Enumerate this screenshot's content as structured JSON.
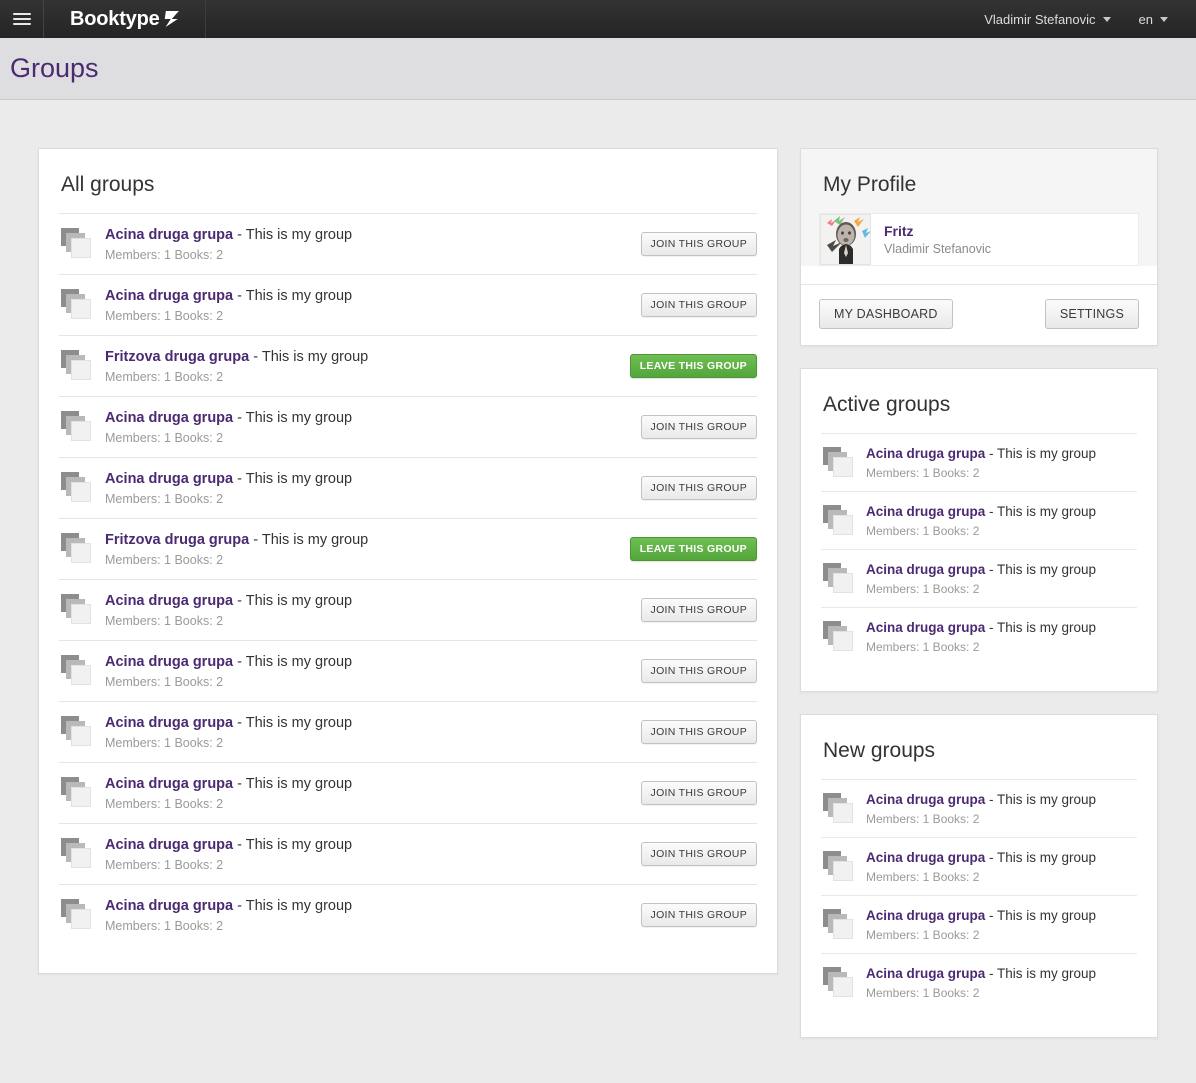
{
  "topbar": {
    "menu_icon": "hamburger-icon",
    "brand": "Booktype",
    "brand_arrow_icon": "chevron-right-arrow-icon",
    "user_name": "Vladimir Stefanovic",
    "user_caret_icon": "caret-down-icon",
    "language": "en",
    "lang_caret_icon": "caret-down-icon"
  },
  "page": {
    "title": "Groups",
    "title_color": "#4b2a72",
    "background": "#ebebeb"
  },
  "all_groups": {
    "heading": "All groups",
    "join_label": "JOIN THIS GROUP",
    "leave_label": "LEAVE THIS GROUP",
    "rows": [
      {
        "name": "Acina druga grupa",
        "desc": " - This is my group",
        "meta": "Members: 1 Books: 2",
        "joined": false
      },
      {
        "name": "Acina druga grupa",
        "desc": " - This is my group",
        "meta": "Members: 1 Books: 2",
        "joined": false
      },
      {
        "name": "Fritzova druga grupa",
        "desc": " - This is my group",
        "meta": "Members: 1 Books: 2",
        "joined": true
      },
      {
        "name": "Acina druga grupa",
        "desc": " - This is my group",
        "meta": "Members: 1 Books: 2",
        "joined": false
      },
      {
        "name": "Acina druga grupa",
        "desc": " - This is my group",
        "meta": "Members: 1 Books: 2",
        "joined": false
      },
      {
        "name": "Fritzova druga grupa",
        "desc": " - This is my group",
        "meta": "Members: 1 Books: 2",
        "joined": true
      },
      {
        "name": "Acina druga grupa",
        "desc": " - This is my group",
        "meta": "Members: 1 Books: 2",
        "joined": false
      },
      {
        "name": "Acina druga grupa",
        "desc": " - This is my group",
        "meta": "Members: 1 Books: 2",
        "joined": false
      },
      {
        "name": "Acina druga grupa",
        "desc": " - This is my group",
        "meta": "Members: 1 Books: 2",
        "joined": false
      },
      {
        "name": "Acina druga grupa",
        "desc": " - This is my group",
        "meta": "Members: 1 Books: 2",
        "joined": false
      },
      {
        "name": "Acina druga grupa",
        "desc": " - This is my group",
        "meta": "Members: 1 Books: 2",
        "joined": false
      },
      {
        "name": "Acina druga grupa",
        "desc": " - This is my group",
        "meta": "Members: 1 Books: 2",
        "joined": false
      }
    ]
  },
  "profile": {
    "heading": "My Profile",
    "avatar_icon": "user-avatar-photo",
    "nickname": "Fritz",
    "full_name": "Vladimir Stefanovic",
    "dashboard_label": "MY DASHBOARD",
    "settings_label": "SETTINGS"
  },
  "active_groups": {
    "heading": "Active groups",
    "rows": [
      {
        "name": "Acina druga grupa",
        "desc": " - This is my group",
        "meta": "Members: 1 Books: 2"
      },
      {
        "name": "Acina druga grupa",
        "desc": " - This is my group",
        "meta": "Members: 1 Books: 2"
      },
      {
        "name": "Acina druga grupa",
        "desc": " - This is my group",
        "meta": "Members: 1 Books: 2"
      },
      {
        "name": "Acina druga grupa",
        "desc": " - This is my group",
        "meta": "Members: 1 Books: 2"
      }
    ]
  },
  "new_groups": {
    "heading": "New groups",
    "rows": [
      {
        "name": "Acina druga grupa",
        "desc": " - This is my group",
        "meta": "Members: 1 Books: 2"
      },
      {
        "name": "Acina druga grupa",
        "desc": " - This is my group",
        "meta": "Members: 1 Books: 2"
      },
      {
        "name": "Acina druga grupa",
        "desc": " - This is my group",
        "meta": "Members: 1 Books: 2"
      },
      {
        "name": "Acina druga grupa",
        "desc": " - This is my group",
        "meta": "Members: 1 Books: 2"
      }
    ]
  },
  "colors": {
    "accent_purple": "#4b2a72",
    "leave_green": "#53a63b",
    "topbar_dark": "#2b2b2b",
    "titlebar_gray": "#dedee0"
  }
}
